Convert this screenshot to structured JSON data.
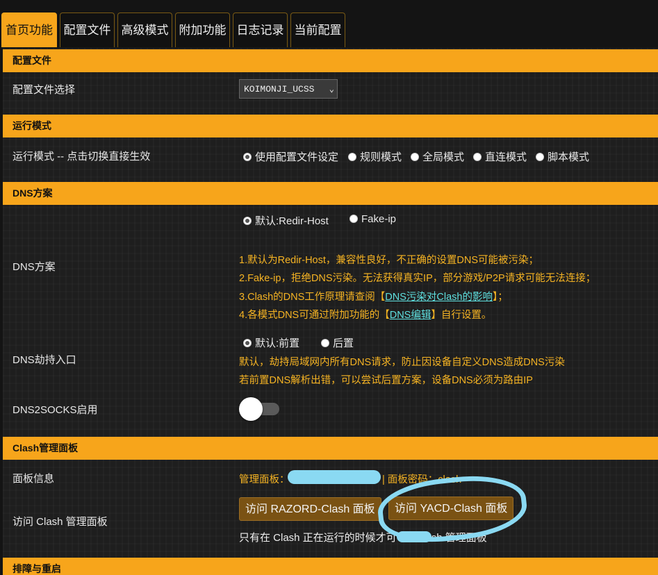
{
  "tabs": [
    "首页功能",
    "配置文件",
    "高级模式",
    "附加功能",
    "日志记录",
    "当前配置"
  ],
  "sections": {
    "config": {
      "header": "配置文件",
      "select_label": "配置文件选择",
      "select_value": "KOIMONJI_UCSS"
    },
    "run_mode": {
      "header": "运行模式",
      "label": "运行模式 -- 点击切换直接生效",
      "options": [
        "使用配置文件设定",
        "规则模式",
        "全局模式",
        "直连模式",
        "脚本模式"
      ],
      "selected": "使用配置文件设定"
    },
    "dns": {
      "header": "DNS方案",
      "label": "DNS方案",
      "options": [
        "默认:Redir-Host",
        "Fake-ip"
      ],
      "selected": "默认:Redir-Host",
      "note1": "1.默认为Redir-Host，兼容性良好，不正确的设置DNS可能被污染；",
      "note2": "2.Fake-ip，拒绝DNS污染。无法获得真实IP，部分游戏/P2P请求可能无法连接；",
      "note3_pre": "3.Clash的DNS工作原理请查阅【",
      "note3_link": "DNS污染对Clash的影响",
      "note3_post": "】；",
      "note4_pre": "4.各模式DNS可通过附加功能的【",
      "note4_link": "DNS编辑",
      "note4_post": "】自行设置。",
      "hijack_label": "DNS劫持入口",
      "hijack_options": [
        "默认:前置",
        "后置"
      ],
      "hijack_selected": "默认:前置",
      "hijack_note1": "默认，劫持局域网内所有DNS请求，防止因设备自定义DNS造成DNS污染",
      "hijack_note2": "若前置DNS解析出错，可以尝试后置方案，设备DNS必须为路由IP",
      "socks_label": "DNS2SOCKS启用"
    },
    "clash": {
      "header": "Clash管理面板",
      "info_label": "面板信息",
      "info_prefix": "管理面板：",
      "info_suffix": "| 面板密码：clash",
      "access_label": "访问 Clash 管理面板",
      "btn_razord": "访问 RAZORD-Clash 面板",
      "btn_yacd": "访问 YACD-Clash 面板",
      "access_note_pre": "只有在 Clash 正在运行的时候才可",
      "access_note_post": "sh 管理面板"
    },
    "troubleshoot": {
      "header": "排障与重启"
    }
  },
  "colors": {
    "accent": "#f7a51b",
    "note": "#f5b323",
    "link": "#5fe0e0",
    "annotation": "#8ad9f2"
  }
}
